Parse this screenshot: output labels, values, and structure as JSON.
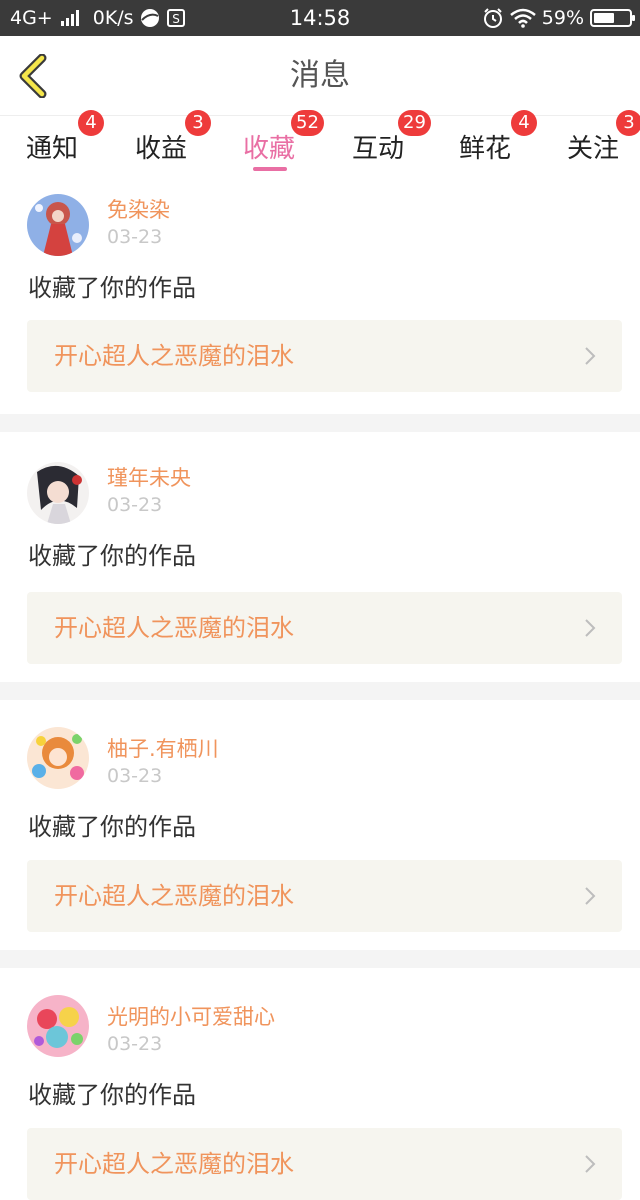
{
  "status_bar": {
    "network": "4G+",
    "speed": "0K/s",
    "time": "14:58",
    "battery": "59%",
    "battery_level": 0.59,
    "icons": [
      "signal-icon",
      "browser-icon",
      "sim-icon",
      "alarm-icon",
      "wifi-icon",
      "battery-icon"
    ]
  },
  "header": {
    "title": "消息",
    "back_icon": "back-chevron-icon"
  },
  "colors": {
    "accent_pink": "#e96fa4",
    "badge_red": "#ee3b3b",
    "link_orange": "#f0945c",
    "card_bg": "#f6f5ef"
  },
  "tabs": [
    {
      "label": "通知",
      "badge": "4",
      "active": false
    },
    {
      "label": "收益",
      "badge": "3",
      "active": false
    },
    {
      "label": "收藏",
      "badge": "52",
      "active": true
    },
    {
      "label": "互动",
      "badge": "29",
      "active": false
    },
    {
      "label": "鲜花",
      "badge": "4",
      "active": false
    },
    {
      "label": "关注",
      "badge": "3",
      "active": false
    }
  ],
  "messages": [
    {
      "username": "免染染",
      "date": "03-23",
      "action": "收藏了你的作品",
      "work_title": "开心超人之恶魔的泪水"
    },
    {
      "username": "瑾年未央",
      "date": "03-23",
      "action": "收藏了你的作品",
      "work_title": "开心超人之恶魔的泪水"
    },
    {
      "username": "柚子.有栖川",
      "date": "03-23",
      "action": "收藏了你的作品",
      "work_title": "开心超人之恶魔的泪水"
    },
    {
      "username": "光明的小可爱甜心",
      "date": "03-23",
      "action": "收藏了你的作品",
      "work_title": "开心超人之恶魔的泪水"
    }
  ]
}
